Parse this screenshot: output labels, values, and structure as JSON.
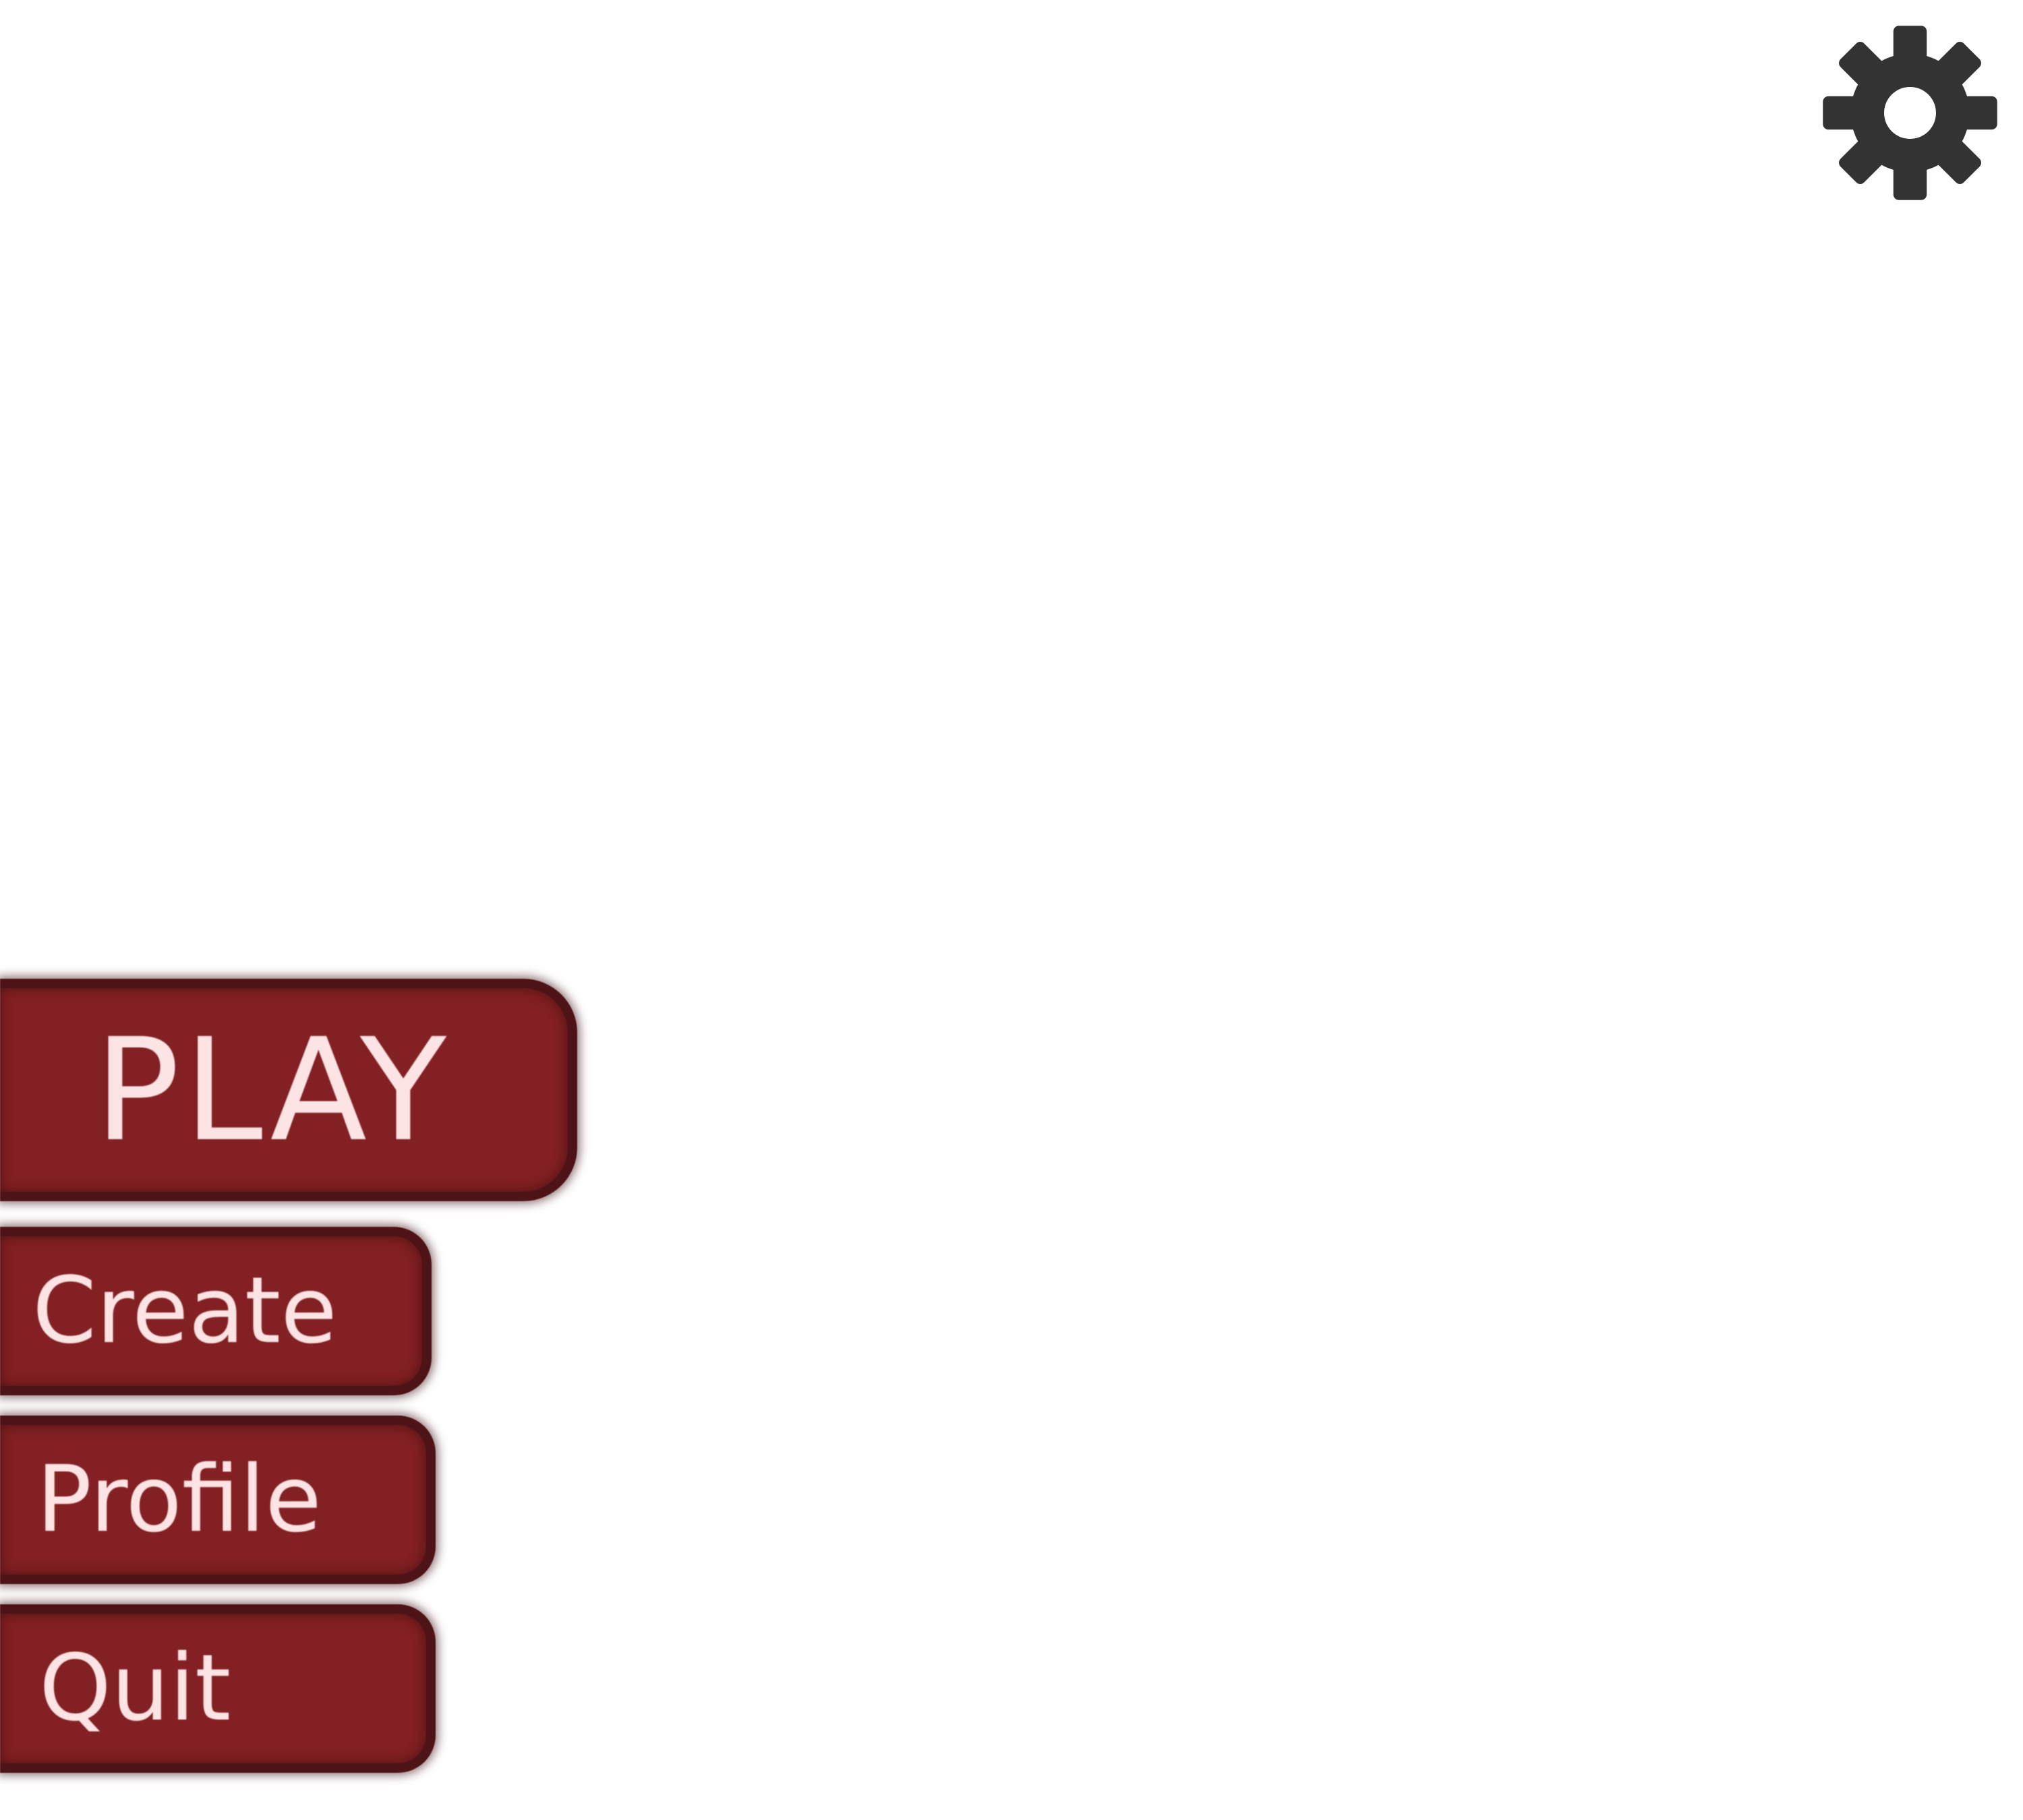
{
  "settings": {
    "icon": "gear-icon",
    "color": "#333333"
  },
  "menu": {
    "play_label": "PLAY",
    "create_label": "Create",
    "profile_label": "Profile",
    "quit_label": "Quit",
    "button_color": "#822023",
    "button_border_color": "#4e1316",
    "text_color": "#fce4e4"
  }
}
